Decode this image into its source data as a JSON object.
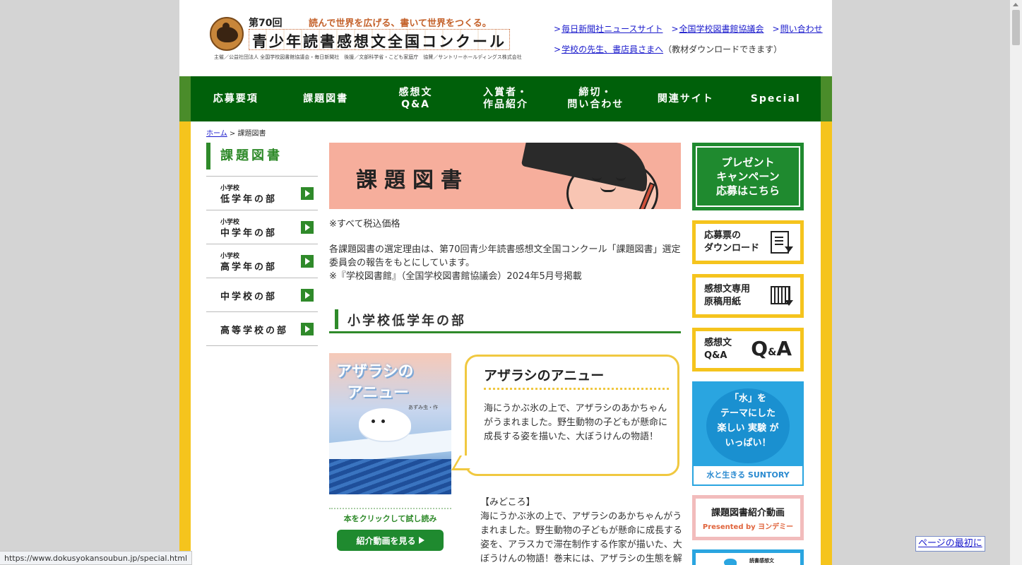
{
  "header": {
    "edition": "第70回",
    "catchphrase": "読んで世界を広げる、書いて世界をつくる。",
    "title": "青少年読書感想文全国コンクール",
    "organizers": "主催／公益社団法人 全国学校図書館協議会・毎日新聞社　後援／文部科学省・こども家庭庁　協賛／サントリーホールディングス株式会社",
    "links": [
      "毎日新聞社ニュースサイト",
      "全国学校図書館協議会",
      "問い合わせ"
    ],
    "teacher_link": "学校の先生、書店員さまへ",
    "teacher_note": "（教材ダウンロードできます）",
    "arrow": ">"
  },
  "nav": [
    "応募要項",
    "課題図書",
    "感想文\nQ&A",
    "入賞者・\n作品紹介",
    "締切・\n問い合わせ",
    "関連サイト",
    "Special"
  ],
  "breadcrumb": {
    "home": "ホーム",
    "sep": " > ",
    "current": "課題図書"
  },
  "sidebar": {
    "title": "課題図書",
    "items": [
      {
        "sub": "小学校",
        "main": "低学年の部"
      },
      {
        "sub": "小学校",
        "main": "中学年の部"
      },
      {
        "sub": "小学校",
        "main": "高学年の部"
      },
      {
        "sub": "",
        "main": "中学校の部"
      },
      {
        "sub": "",
        "main": "高等学校の部"
      }
    ]
  },
  "main": {
    "banner_title": "課題図書",
    "tax_note": "※すべて税込価格",
    "intro_1": "各課題図書の選定理由は、第70回青少年読書感想文全国コンクール「課題図書」選定委員会の報告をもとにしています。",
    "intro_2": "※『学校図書館』（全国学校図書館協議会）2024年5月号掲載",
    "section_title": "小学校低学年の部",
    "book": {
      "cover_title_1": "アザラシの",
      "cover_title_2": "アニュー",
      "cover_author": "あずみ虫・作",
      "title": "アザラシのアニュー",
      "description": "海にうかぶ氷の上で、アザラシのあかちゃんがうまれました。野生動物の子どもが懸命に成長する姿を描いた、大ぼうけんの物語！",
      "try_read": "本をクリックして試し読み",
      "video_button": "紹介動画を見る",
      "midokoro_label": "【みどころ】",
      "midokoro_text": "海にうかぶ氷の上で、アザラシのあかちゃんがうまれました。野生動物の子どもが懸命に成長する姿を、アラスカで滞在制作する作家が描いた、大ぼうけんの物語！巻末には、アザラシの生態を解説した同じシリーズ作品の…"
    }
  },
  "right_sidebar": {
    "present": "プレゼント\nキャンペーン\n応募はこちら",
    "download": "応募票の\nダウンロード",
    "paper": "感想文専用\n原稿用紙",
    "qa_label": "感想文\nQ&A",
    "qa_q": "Q",
    "qa_amp": "&",
    "qa_a": "A",
    "water_text": "「水」を\nテーマにした\n楽しい 実験 が\nいっぱい！",
    "water_foot": "水と生きる SUNTORY",
    "video_title": "課題図書紹介動画",
    "video_sub": "Presented by ヨンデミー",
    "bottom_text": "読書感想文"
  },
  "browser": {
    "status_url": "https://www.dokusyokansoubun.jp/special.html",
    "page_top": "ページの最初に"
  }
}
